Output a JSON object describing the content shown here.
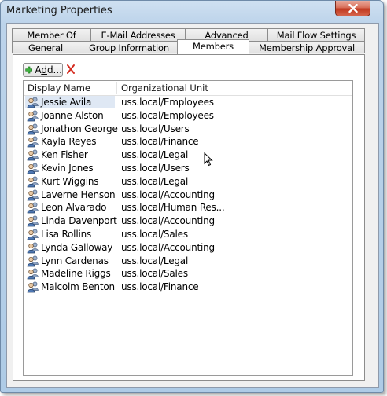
{
  "window": {
    "title": "Marketing Properties"
  },
  "tabs_top": [
    {
      "label": "Member Of"
    },
    {
      "label": "E-Mail Addresses"
    },
    {
      "label": "Advanced"
    },
    {
      "label": "Mail Flow Settings"
    }
  ],
  "tabs_bottom": [
    {
      "label": "General"
    },
    {
      "label": "Group Information"
    },
    {
      "label": "Members",
      "active": true
    },
    {
      "label": "Membership Approval"
    }
  ],
  "toolbar": {
    "add_label_pre": "A",
    "add_label_u": "d",
    "add_label_post": "d..."
  },
  "list": {
    "columns": [
      "Display Name",
      "Organizational Unit"
    ],
    "rows": [
      {
        "name": "Jessie Avila",
        "ou": "uss.local/Employees"
      },
      {
        "name": "Joanne Alston",
        "ou": "uss.local/Employees"
      },
      {
        "name": "Jonathon George",
        "ou": "uss.local/Users"
      },
      {
        "name": "Kayla Reyes",
        "ou": "uss.local/Finance"
      },
      {
        "name": "Ken Fisher",
        "ou": "uss.local/Legal"
      },
      {
        "name": "Kevin Jones",
        "ou": "uss.local/Users"
      },
      {
        "name": "Kurt Wiggins",
        "ou": "uss.local/Legal"
      },
      {
        "name": "Laverne Henson",
        "ou": "uss.local/Accounting"
      },
      {
        "name": "Leon Alvarado",
        "ou": "uss.local/Human Res..."
      },
      {
        "name": "Linda Davenport",
        "ou": "uss.local/Accounting"
      },
      {
        "name": "Lisa Rollins",
        "ou": "uss.local/Sales"
      },
      {
        "name": "Lynda Galloway",
        "ou": "uss.local/Accounting"
      },
      {
        "name": "Lynn Cardenas",
        "ou": "uss.local/Legal"
      },
      {
        "name": "Madeline Riggs",
        "ou": "uss.local/Sales"
      },
      {
        "name": "Malcolm Benton",
        "ou": "uss.local/Finance"
      }
    ]
  },
  "colors": {
    "accent_close": "#c0391f",
    "add_green": "#2e9e2e",
    "remove_red": "#d42a1e"
  },
  "icons": {
    "close": "close-icon",
    "add": "add-plus-icon",
    "remove": "remove-x-icon",
    "user": "group-user-icon"
  }
}
